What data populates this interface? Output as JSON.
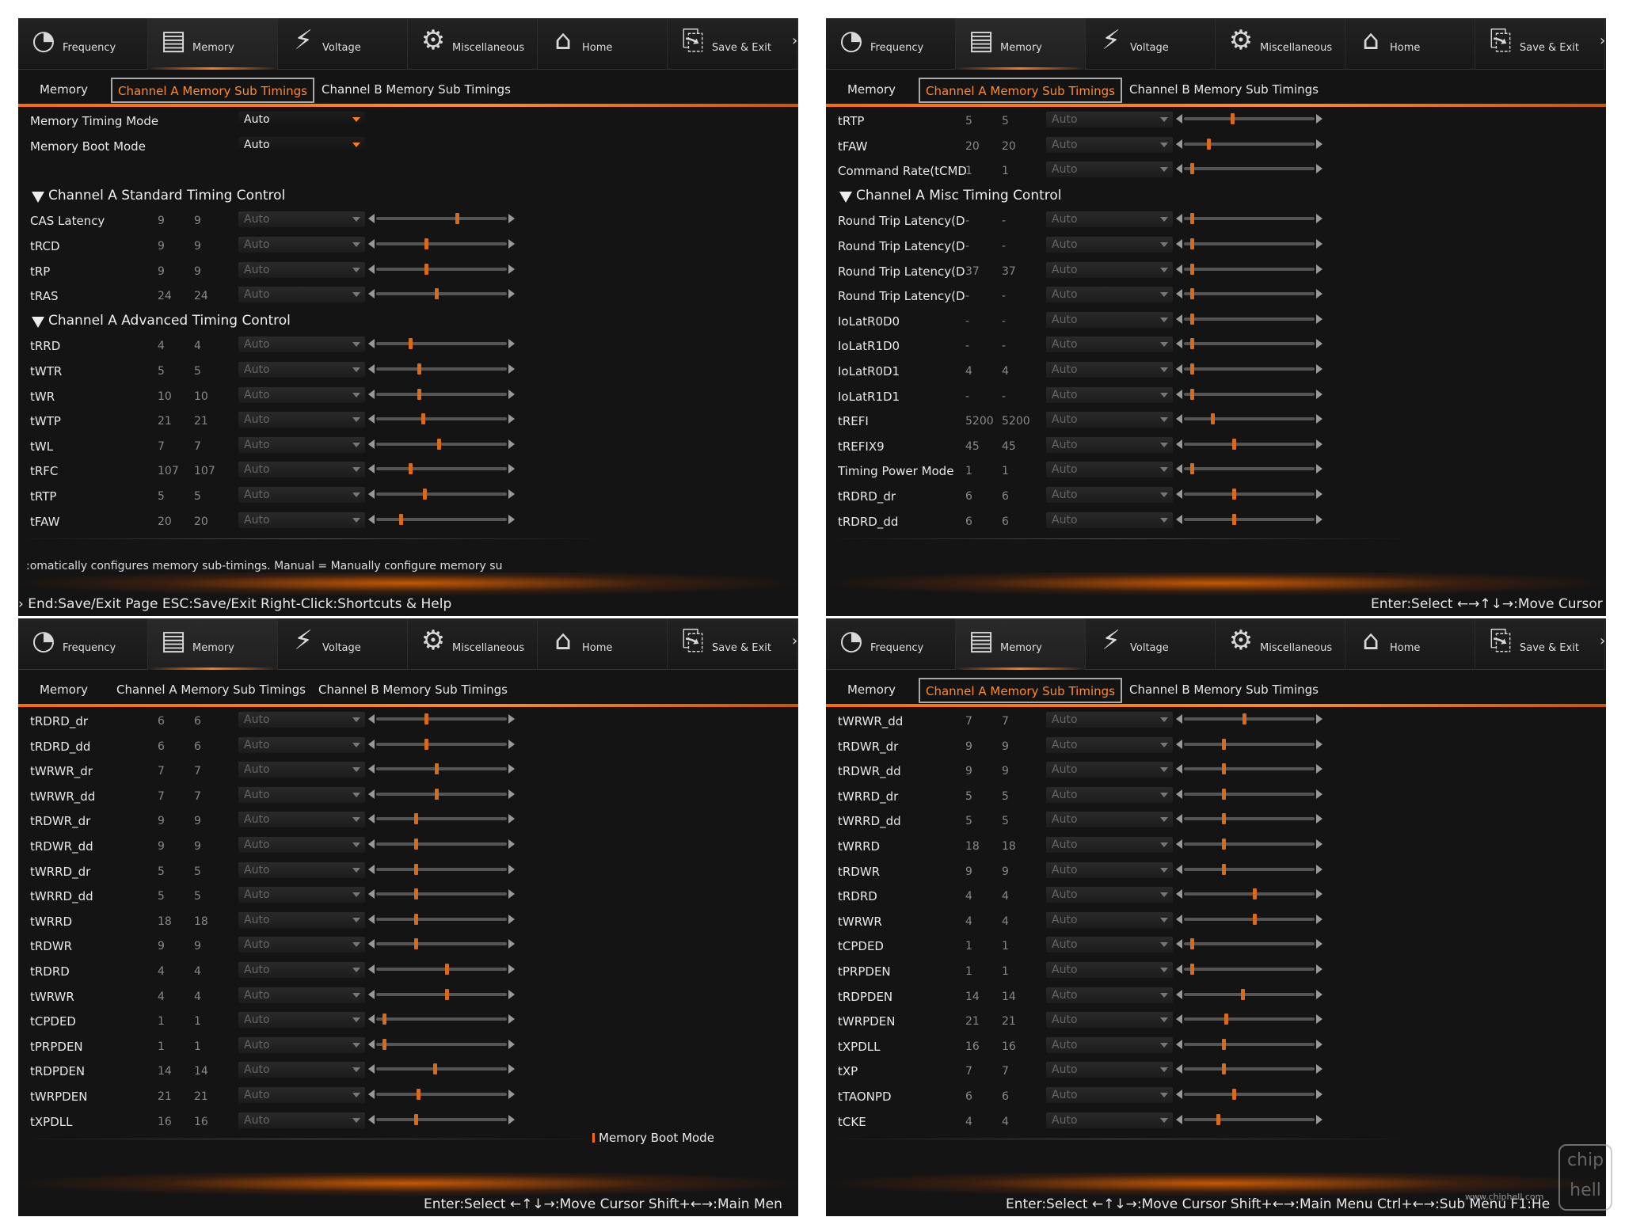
{
  "nav": {
    "items": [
      {
        "label": "Frequency",
        "icon": "frequency-dial-icon"
      },
      {
        "label": "Memory",
        "icon": "memory-module-icon"
      },
      {
        "label": "Voltage",
        "icon": "lightning-icon"
      },
      {
        "label": "Miscellaneous",
        "icon": "gear-icon"
      },
      {
        "label": "Home",
        "icon": "home-icon"
      },
      {
        "label": "Save & Exit",
        "icon": "exit-icon"
      }
    ],
    "active": "Memory"
  },
  "tabs": [
    "Memory",
    "Channel A Memory Sub Timings",
    "Channel B Memory Sub Timings"
  ],
  "accent_color": "#ff7a1a",
  "panels": [
    {
      "modes": [
        {
          "label": "Memory Timing Mode",
          "value": "Auto"
        },
        {
          "label": "Memory Boot Mode",
          "value": "Auto"
        }
      ],
      "sections": [
        {
          "title": "Channel A Standard Timing Control",
          "rows": [
            {
              "label": "CAS Latency",
              "v1": "9",
              "v2": "9",
              "value": "Auto",
              "pos": 0.62
            },
            {
              "label": "tRCD",
              "v1": "9",
              "v2": "9",
              "value": "Auto",
              "pos": 0.38
            },
            {
              "label": "tRP",
              "v1": "9",
              "v2": "9",
              "value": "Auto",
              "pos": 0.38
            },
            {
              "label": "tRAS",
              "v1": "24",
              "v2": "24",
              "value": "Auto",
              "pos": 0.46
            }
          ]
        },
        {
          "title": "Channel A Advanced Timing Control",
          "rows": [
            {
              "label": "tRRD",
              "v1": "4",
              "v2": "4",
              "value": "Auto",
              "pos": 0.26
            },
            {
              "label": "tWTR",
              "v1": "5",
              "v2": "5",
              "value": "Auto",
              "pos": 0.33
            },
            {
              "label": "tWR",
              "v1": "10",
              "v2": "10",
              "value": "Auto",
              "pos": 0.33
            },
            {
              "label": "tWTP",
              "v1": "21",
              "v2": "21",
              "value": "Auto",
              "pos": 0.36
            },
            {
              "label": "tWL",
              "v1": "7",
              "v2": "7",
              "value": "Auto",
              "pos": 0.48
            },
            {
              "label": "tRFC",
              "v1": "107",
              "v2": "107",
              "value": "Auto",
              "pos": 0.26
            },
            {
              "label": "tRTP",
              "v1": "5",
              "v2": "5",
              "value": "Auto",
              "pos": 0.37
            },
            {
              "label": "tFAW",
              "v1": "20",
              "v2": "20",
              "value": "Auto",
              "pos": 0.19
            }
          ]
        }
      ],
      "help": ":omatically configures memory sub-timings.  Manual = Manually configure memory su",
      "footer": "› End:Save/Exit Page ESC:Save/Exit Right-Click:Shortcuts & Help"
    },
    {
      "rows_top": [
        {
          "label": "tRTP",
          "v1": "5",
          "v2": "5",
          "value": "Auto",
          "pos": 0.37
        },
        {
          "label": "tFAW",
          "v1": "20",
          "v2": "20",
          "value": "Auto",
          "pos": 0.19
        },
        {
          "label": "Command Rate(tCMD",
          "v1": "1",
          "v2": "1",
          "value": "Auto",
          "pos": 0.06
        }
      ],
      "section_title": "Channel A Misc Timing Control",
      "rows": [
        {
          "label": "Round Trip Latency(D",
          "v1": "-",
          "v2": "-",
          "value": "Auto",
          "pos": 0.06
        },
        {
          "label": "Round Trip Latency(D",
          "v1": "-",
          "v2": "-",
          "value": "Auto",
          "pos": 0.06
        },
        {
          "label": "Round Trip Latency(D",
          "v1": "37",
          "v2": "37",
          "value": "Auto",
          "pos": 0.06
        },
        {
          "label": "Round Trip Latency(D",
          "v1": "-",
          "v2": "-",
          "value": "Auto",
          "pos": 0.06
        },
        {
          "label": "IoLatR0D0",
          "v1": "-",
          "v2": "-",
          "value": "Auto",
          "pos": 0.06
        },
        {
          "label": "IoLatR1D0",
          "v1": "-",
          "v2": "-",
          "value": "Auto",
          "pos": 0.06
        },
        {
          "label": "IoLatR0D1",
          "v1": "4",
          "v2": "4",
          "value": "Auto",
          "pos": 0.06
        },
        {
          "label": "IoLatR1D1",
          "v1": "-",
          "v2": "-",
          "value": "Auto",
          "pos": 0.06
        },
        {
          "label": "tREFI",
          "v1": "5200",
          "v2": "5200",
          "value": "Auto",
          "pos": 0.22
        },
        {
          "label": "tREFIX9",
          "v1": "45",
          "v2": "45",
          "value": "Auto",
          "pos": 0.38
        },
        {
          "label": "Timing Power Mode",
          "v1": "1",
          "v2": "1",
          "value": "Auto",
          "pos": 0.06
        },
        {
          "label": "tRDRD_dr",
          "v1": "6",
          "v2": "6",
          "value": "Auto",
          "pos": 0.38
        },
        {
          "label": "tRDRD_dd",
          "v1": "6",
          "v2": "6",
          "value": "Auto",
          "pos": 0.38
        }
      ],
      "footer": "Enter:Select ←→↑↓→:Move Cursor"
    },
    {
      "rows": [
        {
          "label": "tRDRD_dr",
          "v1": "6",
          "v2": "6",
          "value": "Auto",
          "pos": 0.38
        },
        {
          "label": "tRDRD_dd",
          "v1": "6",
          "v2": "6",
          "value": "Auto",
          "pos": 0.38
        },
        {
          "label": "tWRWR_dr",
          "v1": "7",
          "v2": "7",
          "value": "Auto",
          "pos": 0.46
        },
        {
          "label": "tWRWR_dd",
          "v1": "7",
          "v2": "7",
          "value": "Auto",
          "pos": 0.46
        },
        {
          "label": "tRDWR_dr",
          "v1": "9",
          "v2": "9",
          "value": "Auto",
          "pos": 0.3
        },
        {
          "label": "tRDWR_dd",
          "v1": "9",
          "v2": "9",
          "value": "Auto",
          "pos": 0.3
        },
        {
          "label": "tWRRD_dr",
          "v1": "5",
          "v2": "5",
          "value": "Auto",
          "pos": 0.3
        },
        {
          "label": "tWRRD_dd",
          "v1": "5",
          "v2": "5",
          "value": "Auto",
          "pos": 0.3
        },
        {
          "label": "tWRRD",
          "v1": "18",
          "v2": "18",
          "value": "Auto",
          "pos": 0.3
        },
        {
          "label": "tRDWR",
          "v1": "9",
          "v2": "9",
          "value": "Auto",
          "pos": 0.3
        },
        {
          "label": "tRDRD",
          "v1": "4",
          "v2": "4",
          "value": "Auto",
          "pos": 0.54
        },
        {
          "label": "tWRWR",
          "v1": "4",
          "v2": "4",
          "value": "Auto",
          "pos": 0.54
        },
        {
          "label": "tCPDED",
          "v1": "1",
          "v2": "1",
          "value": "Auto",
          "pos": 0.06
        },
        {
          "label": "tPRPDEN",
          "v1": "1",
          "v2": "1",
          "value": "Auto",
          "pos": 0.06
        },
        {
          "label": "tRDPDEN",
          "v1": "14",
          "v2": "14",
          "value": "Auto",
          "pos": 0.45
        },
        {
          "label": "tWRPDEN",
          "v1": "21",
          "v2": "21",
          "value": "Auto",
          "pos": 0.32
        },
        {
          "label": "tXPDLL",
          "v1": "16",
          "v2": "16",
          "value": "Auto",
          "pos": 0.3
        }
      ],
      "boot_note": "Memory Boot Mode",
      "footer": "Enter:Select ←↑↓→:Move Cursor Shift+←→:Main Men"
    },
    {
      "rows": [
        {
          "label": "tWRWR_dd",
          "v1": "7",
          "v2": "7",
          "value": "Auto",
          "pos": 0.46
        },
        {
          "label": "tRDWR_dr",
          "v1": "9",
          "v2": "9",
          "value": "Auto",
          "pos": 0.3
        },
        {
          "label": "tRDWR_dd",
          "v1": "9",
          "v2": "9",
          "value": "Auto",
          "pos": 0.3
        },
        {
          "label": "tWRRD_dr",
          "v1": "5",
          "v2": "5",
          "value": "Auto",
          "pos": 0.3
        },
        {
          "label": "tWRRD_dd",
          "v1": "5",
          "v2": "5",
          "value": "Auto",
          "pos": 0.3
        },
        {
          "label": "tWRRD",
          "v1": "18",
          "v2": "18",
          "value": "Auto",
          "pos": 0.3
        },
        {
          "label": "tRDWR",
          "v1": "9",
          "v2": "9",
          "value": "Auto",
          "pos": 0.3
        },
        {
          "label": "tRDRD",
          "v1": "4",
          "v2": "4",
          "value": "Auto",
          "pos": 0.54
        },
        {
          "label": "tWRWR",
          "v1": "4",
          "v2": "4",
          "value": "Auto",
          "pos": 0.54
        },
        {
          "label": "tCPDED",
          "v1": "1",
          "v2": "1",
          "value": "Auto",
          "pos": 0.06
        },
        {
          "label": "tPRPDEN",
          "v1": "1",
          "v2": "1",
          "value": "Auto",
          "pos": 0.06
        },
        {
          "label": "tRDPDEN",
          "v1": "14",
          "v2": "14",
          "value": "Auto",
          "pos": 0.45
        },
        {
          "label": "tWRPDEN",
          "v1": "21",
          "v2": "21",
          "value": "Auto",
          "pos": 0.32
        },
        {
          "label": "tXPDLL",
          "v1": "16",
          "v2": "16",
          "value": "Auto",
          "pos": 0.3
        },
        {
          "label": "tXP",
          "v1": "7",
          "v2": "7",
          "value": "Auto",
          "pos": 0.3
        },
        {
          "label": "tTAONPD",
          "v1": "6",
          "v2": "6",
          "value": "Auto",
          "pos": 0.38
        },
        {
          "label": "tCKE",
          "v1": "4",
          "v2": "4",
          "value": "Auto",
          "pos": 0.26
        }
      ],
      "footer": "Enter:Select ←↑↓→:Move Cursor Shift+←→:Main Menu Ctrl+←→:Sub Menu F1:He"
    }
  ],
  "watermark": {
    "logo": "chip hell",
    "url": "www.chiphell.com"
  }
}
